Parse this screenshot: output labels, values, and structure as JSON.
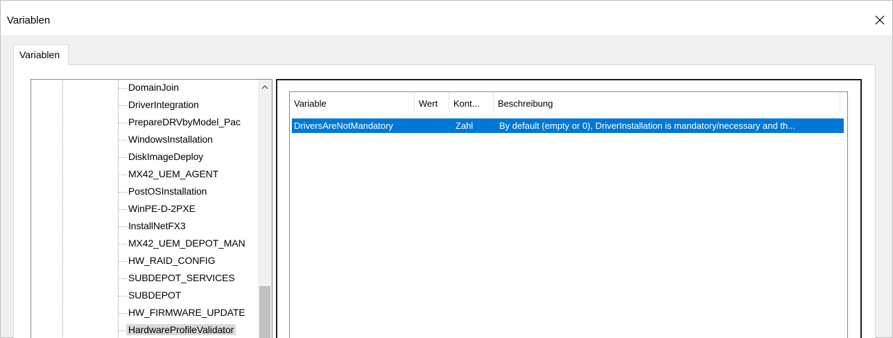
{
  "window": {
    "title": "Variablen",
    "close_symbol": "✕"
  },
  "tabs": [
    {
      "label": "Variablen",
      "active": true
    }
  ],
  "tree": {
    "items": [
      "DomainJoin",
      "DriverIntegration",
      "PrepareDRVbyModel_Pac",
      "WindowsInstallation",
      "DiskImageDeploy",
      "MX42_UEM_AGENT",
      "PostOSInstallation",
      "WinPE-D-2PXE",
      "InstallNetFX3",
      "MX42_UEM_DEPOT_MAN",
      "HW_RAID_CONFIG",
      "SUBDEPOT_SERVICES",
      "SUBDEPOT",
      "HW_FIRMWARE_UPDATE",
      "HardwareProfileValidator"
    ],
    "selected": "HardwareProfileValidator",
    "scroll_up_symbol": "^"
  },
  "table": {
    "columns": [
      "Variable",
      "Wert",
      "Kont...",
      "Beschreibung"
    ],
    "rows": [
      {
        "variable": "DriversAreNotMandatory",
        "wert": "",
        "kont": "Zahl",
        "beschreibung": "By default (empty or 0), DriverInstallation is mandatory/necessary and th..."
      }
    ]
  },
  "colors": {
    "selection": "#0078d7",
    "window_bg": "#f0f0f0"
  }
}
